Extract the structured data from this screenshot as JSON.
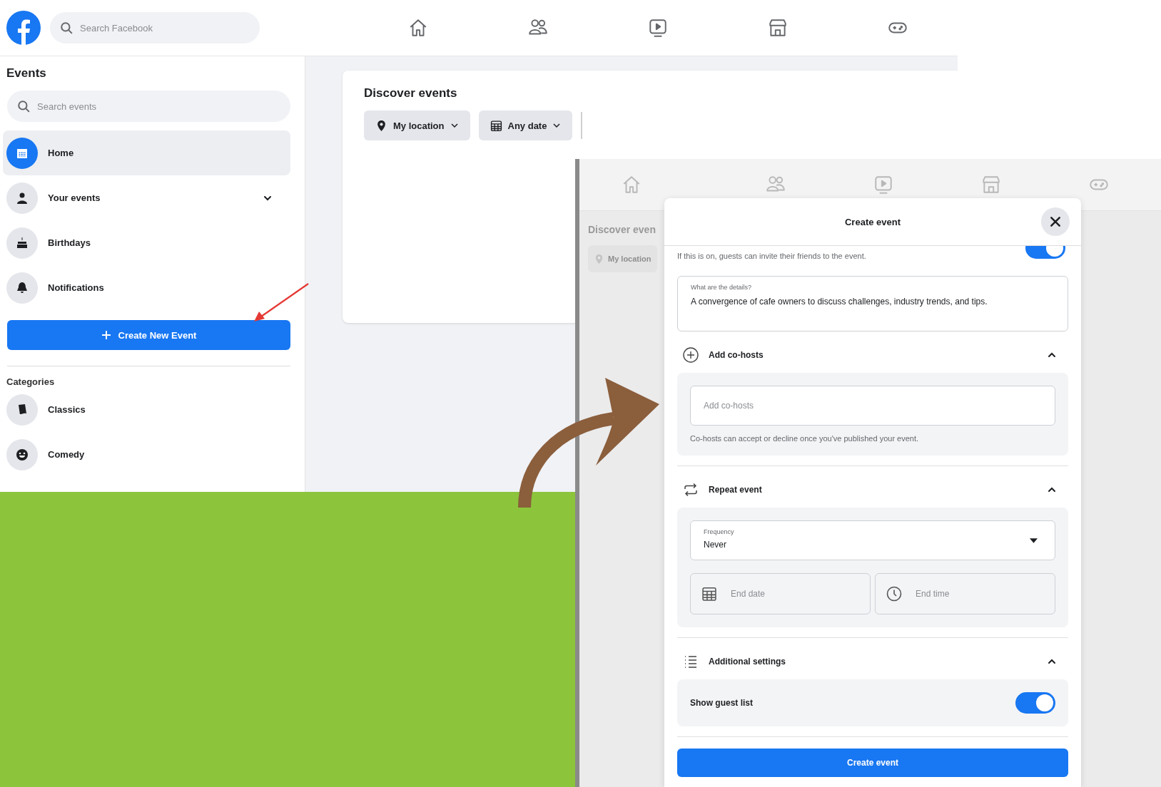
{
  "left_screenshot": {
    "top_bar": {
      "search": {
        "placeholder": "Search Facebook"
      }
    },
    "sidebar": {
      "title": "Events",
      "search": {
        "placeholder": "Search events"
      },
      "items": [
        {
          "label": "Home",
          "selected": true,
          "kind": "link"
        },
        {
          "label": "Your events",
          "selected": false,
          "kind": "dropdown"
        },
        {
          "label": "Birthdays",
          "selected": false,
          "kind": "link"
        },
        {
          "label": "Notifications",
          "selected": false,
          "kind": "link"
        }
      ],
      "create_button": "Create New Event",
      "categories_title": "Categories",
      "categories": [
        {
          "label": "Classics"
        },
        {
          "label": "Comedy"
        }
      ]
    },
    "discover": {
      "title": "Discover events",
      "filters": [
        "My location",
        "Any date"
      ]
    }
  },
  "right_screenshot": {
    "background": {
      "title": "Discover even",
      "filter": "My location"
    },
    "modal": {
      "title": "Create event",
      "guest_invite": {
        "hint": "If this is on, guests can invite their friends to the event.",
        "on": true
      },
      "details": {
        "label": "What are the details?",
        "value": "A convergence of cafe owners to discuss challenges, industry trends, and tips."
      },
      "sections": [
        {
          "kind": "cohosts",
          "title": "Add co-hosts",
          "expanded": true,
          "field": {
            "placeholder": "Add co-hosts"
          },
          "hint": "Co-hosts can accept or decline once you've published your event."
        },
        {
          "kind": "repeat",
          "title": "Repeat event",
          "expanded": true,
          "frequency": {
            "label": "Frequency",
            "value": "Never"
          },
          "end_date": {
            "placeholder": "End date"
          },
          "end_time": {
            "placeholder": "End time"
          }
        },
        {
          "kind": "settings",
          "title": "Additional settings",
          "expanded": true,
          "toggles": [
            {
              "label": "Show guest list",
              "on": true
            }
          ]
        }
      ],
      "submit": "Create event"
    }
  }
}
